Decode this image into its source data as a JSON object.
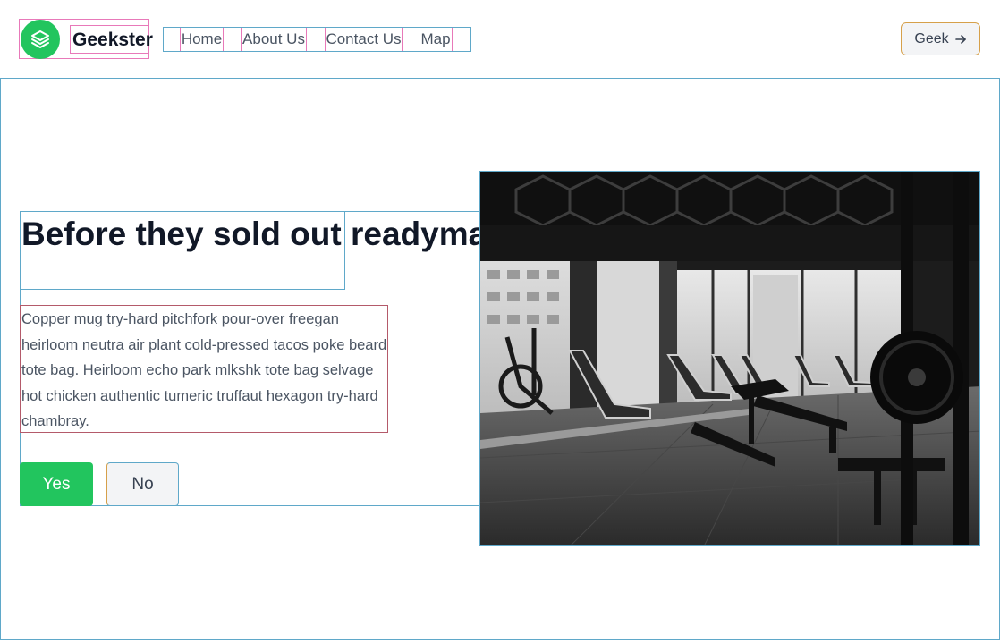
{
  "header": {
    "brand": "Geekster",
    "nav": [
      "Home",
      "About Us",
      "Contact Us",
      "Map"
    ],
    "cta_label": "Geek",
    "cta_icon": "arrow-right-icon",
    "logo_icon": "stack-layers-icon",
    "accent_color": "#22c55e"
  },
  "hero": {
    "title": "Before they sold out readymade gluten",
    "description": "Copper mug try-hard pitchfork pour-over freegan heirloom neutra air plant cold-pressed tacos poke beard tote bag. Heirloom echo park mlkshk tote bag selvage hot chicken authentic tumeric truffaut hexagon try-hard chambray.",
    "yes_label": "Yes",
    "no_label": "No",
    "image": "gym-interior-photo"
  }
}
